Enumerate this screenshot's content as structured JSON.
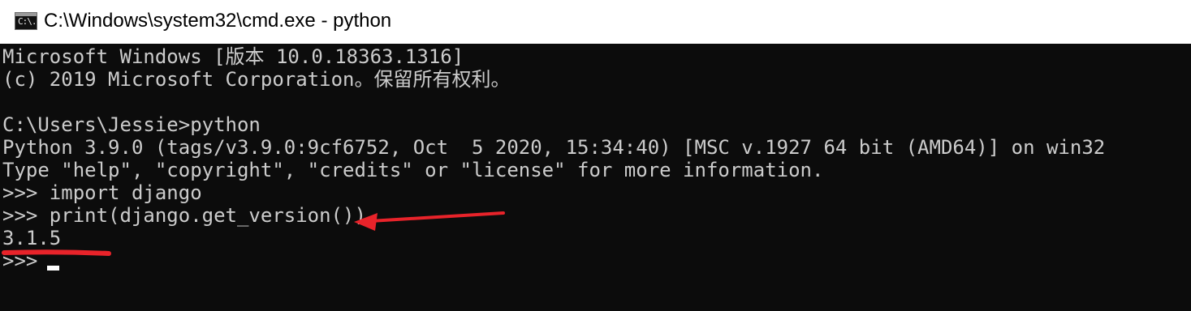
{
  "window": {
    "title": "C:\\Windows\\system32\\cmd.exe - python",
    "icon": "cmd-icon",
    "icon_glyph": "C:\\."
  },
  "terminal": {
    "lines": [
      "Microsoft Windows [版本 10.0.18363.1316]",
      "(c) 2019 Microsoft Corporation。保留所有权利。",
      "",
      "C:\\Users\\Jessie>python",
      "Python 3.9.0 (tags/v3.9.0:9cf6752, Oct  5 2020, 15:34:40) [MSC v.1927 64 bit (AMD64)] on win32",
      "Type \"help\", \"copyright\", \"credits\" or \"license\" for more information.",
      ">>> import django",
      ">>> print(django.get_version())",
      "3.1.5",
      ">>> "
    ]
  },
  "annotations": {
    "color": "#e8232a",
    "arrow_target": "print(django.get_version())",
    "underline_target": "3.1.5"
  },
  "colors": {
    "terminal_background": "#0c0c0c",
    "terminal_text": "#cccccc",
    "titlebar_background": "#ffffff",
    "cursor": "#ffffff"
  }
}
